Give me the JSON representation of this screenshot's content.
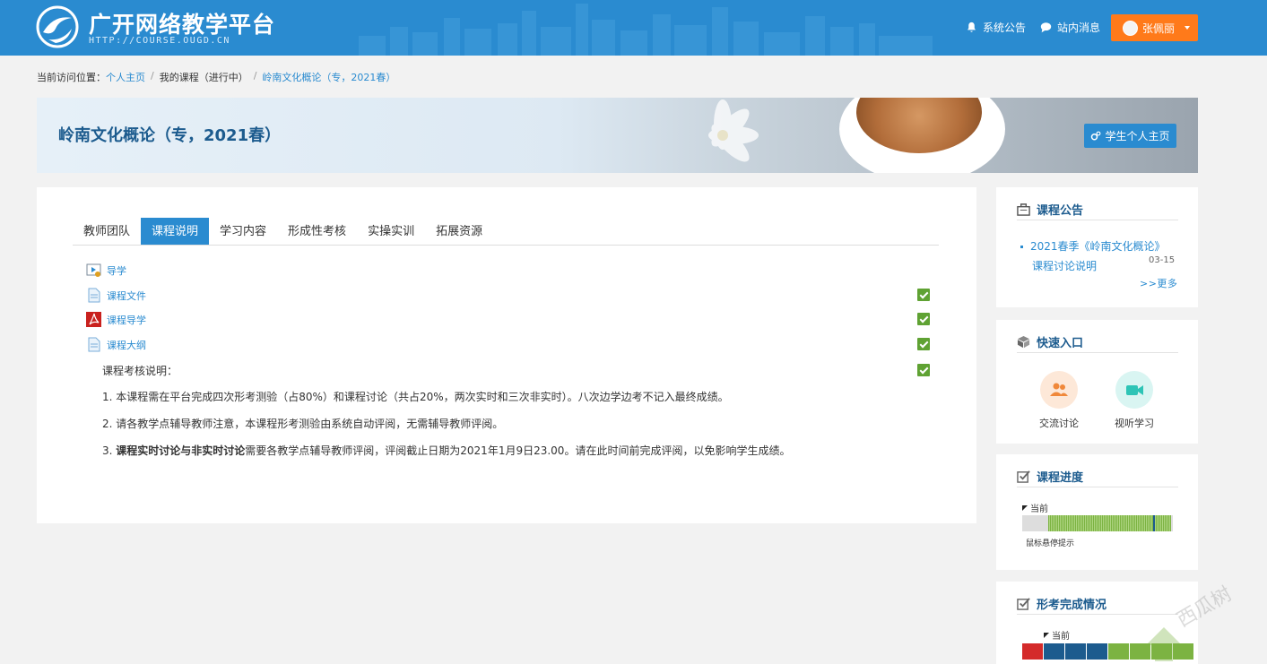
{
  "header": {
    "brand_title": "广开网络教学平台",
    "brand_url": "HTTP://COURSE.OUGD.CN",
    "announcement_label": "系统公告",
    "message_label": "站内消息",
    "user_name": "张佩丽"
  },
  "breadcrumb": {
    "prefix": "当前访问位置：",
    "items": [
      "个人主页",
      "我的课程（进行中）",
      "岭南文化概论（专，2021春）"
    ]
  },
  "banner": {
    "course_title": "岭南文化概论（专，2021春）",
    "student_home_label": "学生个人主页"
  },
  "tabs": [
    "教师团队",
    "课程说明",
    "学习内容",
    "形成性考核",
    "实操实训",
    "拓展资源"
  ],
  "active_tab": "课程说明",
  "items": [
    {
      "label": "导学",
      "icon": "video-icon",
      "checked": false
    },
    {
      "label": "课程文件",
      "icon": "document-icon",
      "checked": true
    },
    {
      "label": "课程导学",
      "icon": "pdf-icon",
      "checked": true
    },
    {
      "label": "课程大纲",
      "icon": "document-icon",
      "checked": true
    }
  ],
  "assessment": {
    "title": "课程考核说明：",
    "lines": [
      "1. 本课程需在平台完成四次形考测验（占80%）和课程讨论（共占20%，两次实时和三次非实时）。八次边学边考不记入最终成绩。",
      "2. 请各教学点辅导教师注意，本课程形考测验由系统自动评阅，无需辅导教师评阅。"
    ],
    "line3_prefix": "3. ",
    "line3_bold": "课程实时讨论与非实时讨论",
    "line3_rest": "需要各教学点辅导教师评阅，评阅截止日期为2021年1月9日23.00。请在此时间前完成评阅，以免影响学生成绩。"
  },
  "sidebar": {
    "notice": {
      "title": "课程公告",
      "item_line1": "2021春季《岭南文化概论》",
      "item_line2": "课程讨论说明",
      "item_date": "03-15",
      "more_label": ">>更多"
    },
    "quick": {
      "title": "快速入口",
      "entries": [
        {
          "label": "交流讨论",
          "icon": "people-icon",
          "color": "#f0883a",
          "bg": "#fde8d8"
        },
        {
          "label": "视听学习",
          "icon": "video-camera-icon",
          "color": "#2ec4b6",
          "bg": "#d9f5f2"
        }
      ]
    },
    "progress": {
      "title": "课程进度",
      "current_label": "当前",
      "hint": "鼠标悬停提示",
      "completed_fraction": 0.82,
      "current_position": 0.87
    },
    "formative": {
      "title": "形考完成情况",
      "current_label": "当前",
      "block_colors": [
        "#d42a2a",
        "#1c5b8e",
        "#1c5b8e",
        "#1c5b8e",
        "#7cb342",
        "#7cb342",
        "#7cb342",
        "#7cb342"
      ]
    }
  },
  "colors": {
    "primary": "#2a8bd0",
    "orange": "#ff7a1a",
    "check_green": "#5fa233"
  }
}
